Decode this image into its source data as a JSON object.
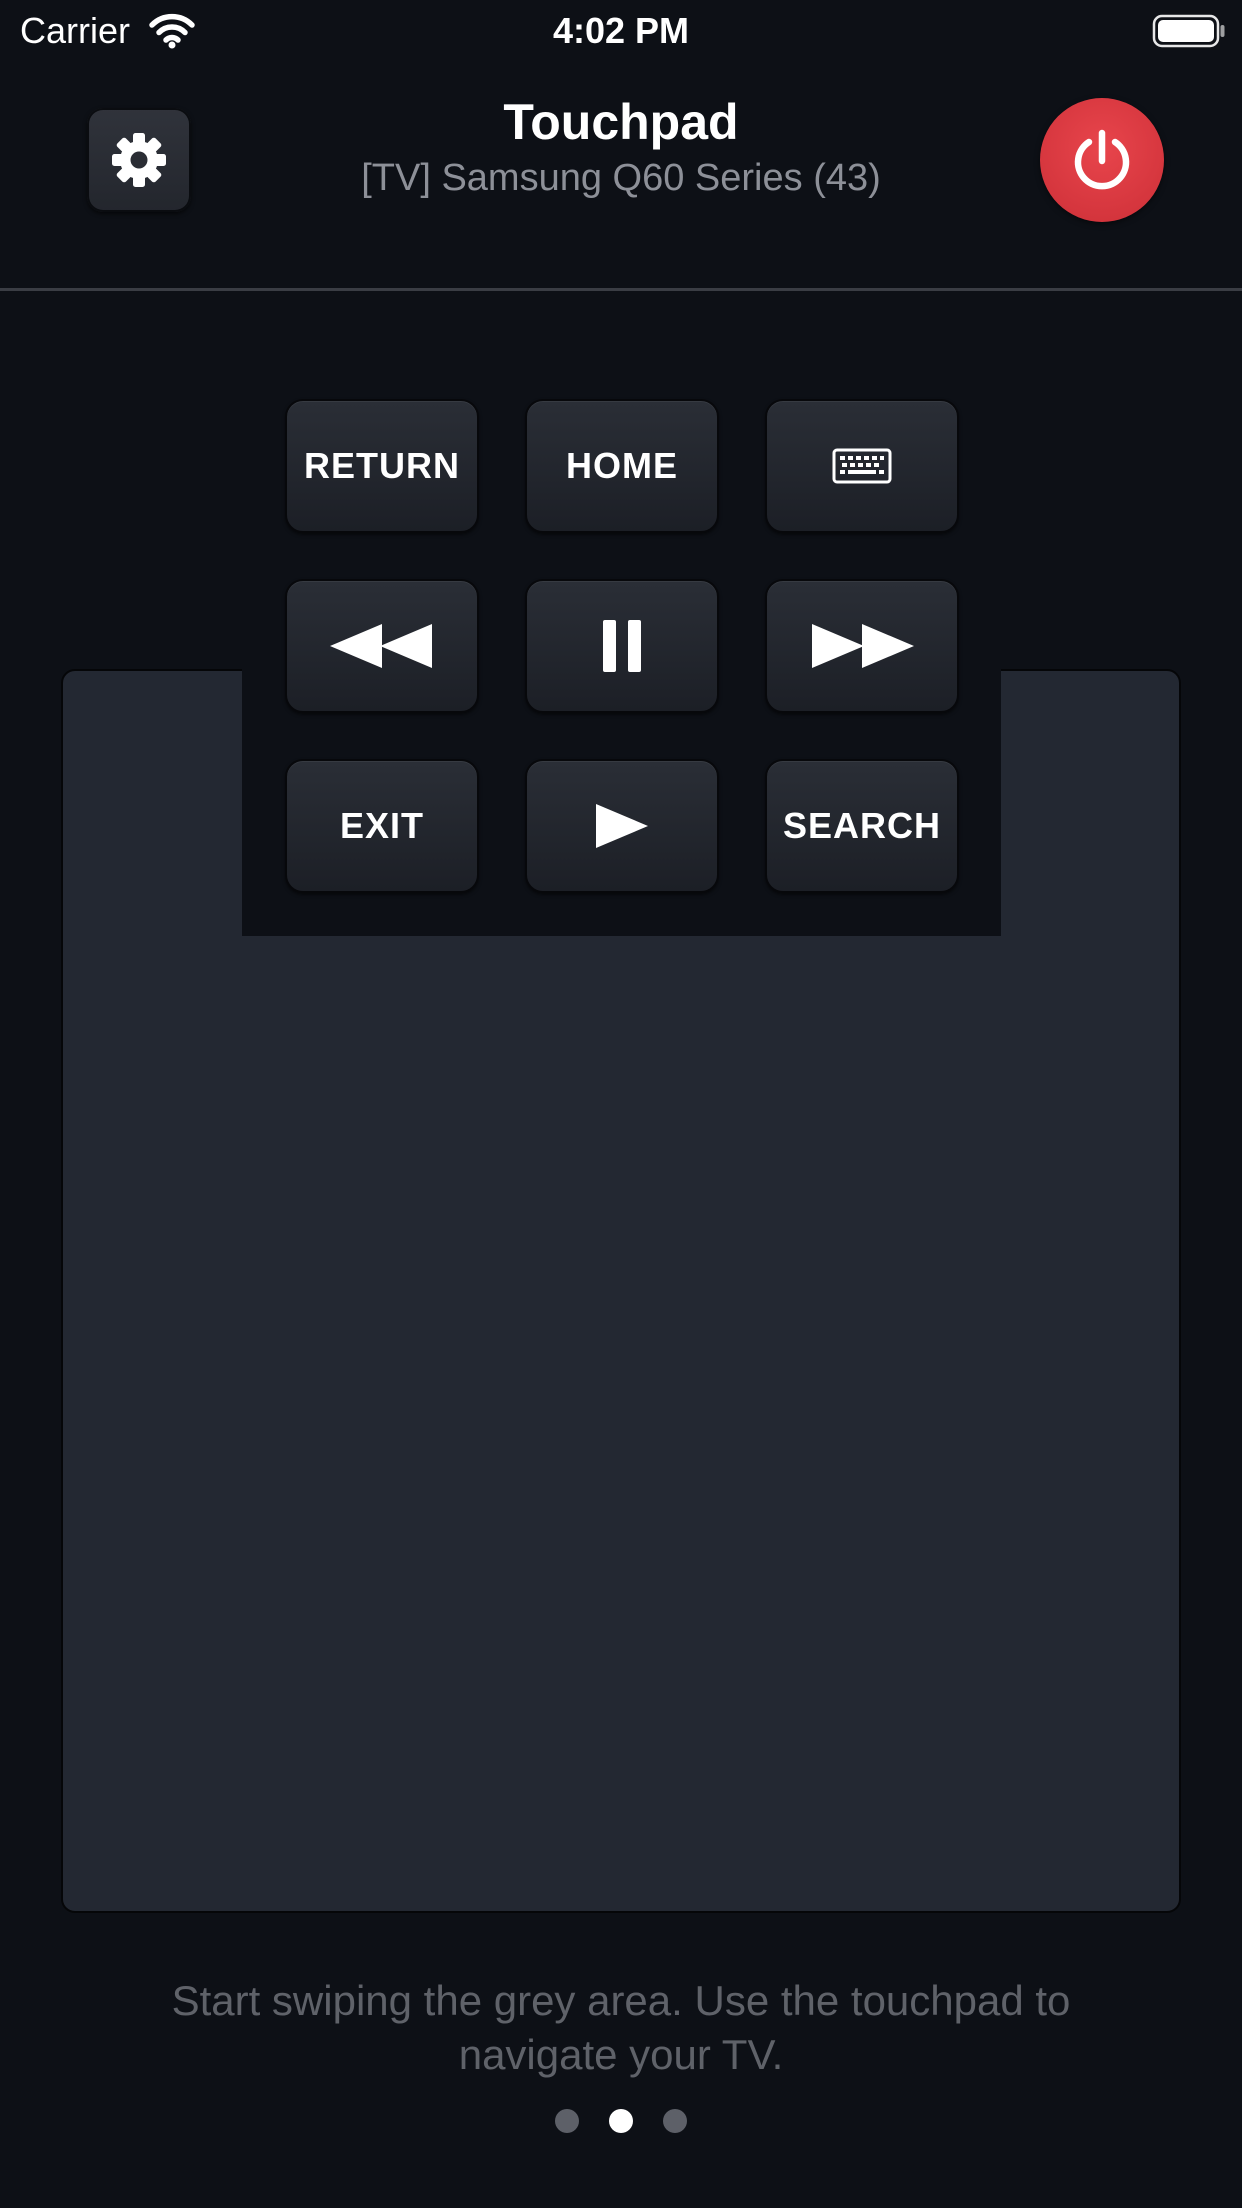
{
  "status_bar": {
    "carrier": "Carrier",
    "time": "4:02 PM"
  },
  "header": {
    "title": "Touchpad",
    "subtitle": "[TV] Samsung Q60 Series (43)"
  },
  "controls": {
    "return_label": "RETURN",
    "home_label": "HOME",
    "keyboard_icon": "keyboard-icon",
    "rewind_icon": "rewind-icon",
    "pause_icon": "pause-icon",
    "fast_forward_icon": "fast-forward-icon",
    "exit_label": "EXIT",
    "play_icon": "play-icon",
    "search_label": "SEARCH"
  },
  "instruction": "Start swiping the grey area. Use the touchpad to navigate your TV.",
  "page_indicator": {
    "count": 3,
    "active_index": 1
  },
  "colors": {
    "background": "#0d1016",
    "touchpad": "#232832",
    "power_button": "#d9363e",
    "subtitle_text": "#8d9098",
    "instruction_text": "#5f6269"
  }
}
